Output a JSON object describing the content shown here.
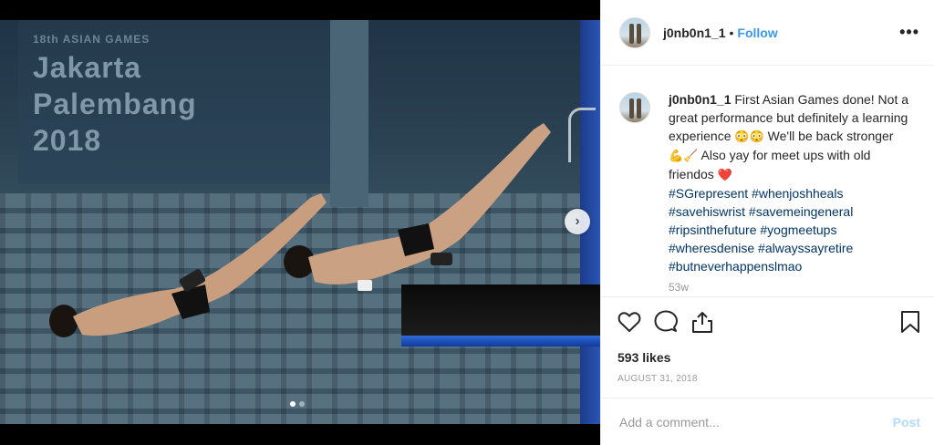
{
  "post": {
    "username": "j0nb0n1_1",
    "separator": "•",
    "follow_label": "Follow",
    "more_label": "•••",
    "caption_user": "j0nb0n1_1",
    "caption_text": "First Asian Games done! Not a great performance but definitely a learning experience",
    "caption_emoji1": "😳😳",
    "caption_text2": "We'll be back stronger",
    "caption_emoji2": "💪🧹",
    "caption_text3": "Also yay for meet ups with old friendos",
    "caption_emoji3": "❤️",
    "hashtags": [
      "#SGrepresent #whenjoshheals",
      "#savehiswrist #savemeingeneral",
      "#ripsinthefuture #yogmeetups",
      "#wheresdenise #alwayssayretire",
      "#butneverhappenslmao"
    ],
    "caption_timestamp": "53w",
    "likes": "593 likes",
    "date": "AUGUST 31, 2018"
  },
  "photo": {
    "banner_small": "18th ASIAN GAMES",
    "banner_line1": "Jakarta",
    "banner_line2": "Palembang",
    "banner_line3": "2018",
    "next_label": "›",
    "carousel_count": 2,
    "carousel_index": 1
  },
  "comment_box": {
    "placeholder": "Add a comment...",
    "post_label": "Post"
  },
  "colors": {
    "link": "#3897f0",
    "hashtag": "#003569",
    "post_disabled": "#b3dbff"
  }
}
